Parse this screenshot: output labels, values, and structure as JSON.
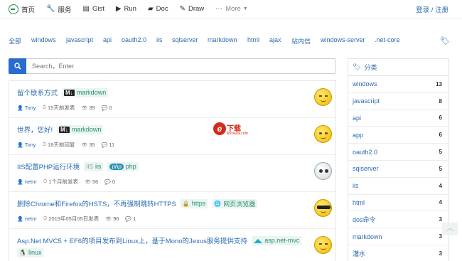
{
  "nav": {
    "home": "首页",
    "services": "服务",
    "gist": "Gist",
    "run": "Run",
    "doc": "Doc",
    "draw": "Draw",
    "more": "More",
    "login": "登录 / 注册"
  },
  "tags": [
    "全部",
    "windows",
    "javascript",
    "api",
    "oauth2.0",
    "iis",
    "sqlserver",
    "markdown",
    "html",
    "ajax",
    "站内信",
    "windows-server",
    ".net-core"
  ],
  "search": {
    "placeholder": "Search，Enter"
  },
  "posts": [
    {
      "title": "留个联系方式",
      "badges": [
        {
          "icon": "markdown-icon",
          "label": "markdown"
        }
      ],
      "author": "Tony",
      "time": "15天前发表",
      "views": "39",
      "comments": "0",
      "avatar": "grin-face"
    },
    {
      "title": "世界，您好!",
      "badges": [
        {
          "icon": "markdown-icon",
          "label": "markdown"
        }
      ],
      "author": "Tony",
      "time": "18天前回复",
      "views": "35",
      "comments": "11",
      "avatar": "smile-face"
    },
    {
      "title": "IIS配置PHP运行环境",
      "badges": [
        {
          "icon": "iis-icon",
          "label": "iis"
        },
        {
          "icon": "php-icon",
          "label": "php"
        }
      ],
      "author": "netnr",
      "time": "1个月前发表",
      "views": "56",
      "comments": "0",
      "avatar": "skull-face"
    },
    {
      "title": "删除Chrome和Firefox的HSTS，不再强制跳转HTTPS",
      "badges": [
        {
          "icon": "lock-icon",
          "label": "https"
        },
        {
          "icon": "globe-icon",
          "label": "网页浏览器"
        }
      ],
      "author": "netnr",
      "time": "2019年05月05日发表",
      "views": "96",
      "comments": "1",
      "avatar": "sunglasses-face"
    },
    {
      "title": "Asp.Net MVC5 + EF6的项目发布到Linux上，基于Mono的Jexus服务提供支持",
      "badges": [
        {
          "icon": "dotnet-icon",
          "label": "asp.net-mvc"
        },
        {
          "icon": "linux-icon",
          "label": "linux"
        }
      ],
      "author": "",
      "time": "",
      "views": "",
      "comments": "",
      "avatar": "smile-face"
    }
  ],
  "watermark": {
    "logo": "e",
    "text": "下载",
    "sub": "A5xiazai.com"
  },
  "categories": {
    "title": "分类",
    "items": [
      {
        "name": "windows",
        "count": "13"
      },
      {
        "name": "javascript",
        "count": "8"
      },
      {
        "name": "api",
        "count": "6"
      },
      {
        "name": "app",
        "count": "6"
      },
      {
        "name": "oauth2.0",
        "count": "5"
      },
      {
        "name": "sqlserver",
        "count": "5"
      },
      {
        "name": "iis",
        "count": "4"
      },
      {
        "name": "html",
        "count": "4"
      },
      {
        "name": "dos命令",
        "count": "3"
      },
      {
        "name": "markdown",
        "count": "3"
      },
      {
        "name": "灌水",
        "count": "3"
      }
    ]
  },
  "colors": {
    "accent": "#2a6bb0",
    "search_button": "#2a6bd0",
    "brand_green": "#2a8f4e"
  }
}
